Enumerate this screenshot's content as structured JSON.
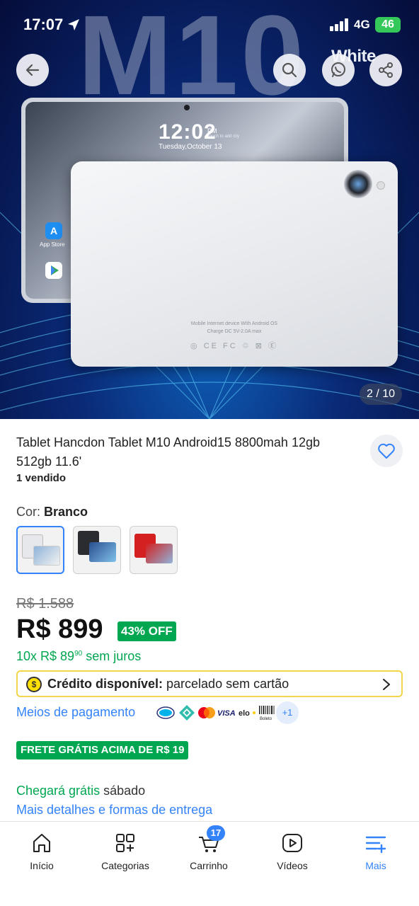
{
  "status_bar": {
    "time": "17:07",
    "network": "4G",
    "battery": "46"
  },
  "hero": {
    "model_text": "M10",
    "color_text": "White",
    "lock_time": "12:02",
    "lock_ampm": "PM",
    "lock_hint": "Touch to add city",
    "lock_date": "Tuesday,October 13",
    "app_store_label": "App Store",
    "back_text_line1": "Mobile Internet device With Android OS",
    "back_text_line2": "Charge DC 5V-2.0A max",
    "back_marks": "◎ CE FC ♲ ⊠ Ⓔ",
    "counter": "2 / 10",
    "buttons": {
      "back": "back-arrow-icon",
      "search": "search-icon",
      "whatsapp": "whatsapp-icon",
      "share": "share-icon"
    }
  },
  "product": {
    "title": "Tablet Hancdon Tablet M10 Android15 8800mah 12gb 512gb 11.6'",
    "sold": "1 vendido",
    "color_label": "Cor: ",
    "color_value": "Branco",
    "variants": [
      {
        "name": "white",
        "color": "#e6e8ec",
        "selected": true
      },
      {
        "name": "black",
        "color": "#2a2c30",
        "selected": false
      },
      {
        "name": "red",
        "color": "#d42020",
        "selected": false
      }
    ]
  },
  "pricing": {
    "old_price": "R$ 1.588",
    "price": "R$ 899",
    "discount": "43% OFF",
    "installment_prefix": "10x R$ 89",
    "installment_cents": "90",
    "installment_suffix": " sem juros"
  },
  "credit": {
    "bold": "Crédito disponível:",
    "rest": " parcelado sem cartão"
  },
  "payment": {
    "label": "Meios de pagamento",
    "methods": [
      "Mercado Pago",
      "Pix",
      "Mastercard",
      "VISA",
      "elo",
      "Boleto"
    ],
    "more": "+1"
  },
  "shipping": {
    "badge": "FRETE GRÁTIS ACIMA DE R$ 19",
    "arrival_green": "Chegará grátis",
    "arrival_rest": " sábado",
    "details_link": "Mais detalhes e formas de entrega"
  },
  "nav": {
    "items": [
      {
        "label": "Início",
        "icon": "home-icon"
      },
      {
        "label": "Categorias",
        "icon": "categories-icon"
      },
      {
        "label": "Carrinho",
        "icon": "cart-icon"
      },
      {
        "label": "Vídeos",
        "icon": "video-icon"
      },
      {
        "label": "Mais",
        "icon": "menu-plus-icon"
      }
    ],
    "cart_count": "17",
    "accent": "#3483fa"
  }
}
